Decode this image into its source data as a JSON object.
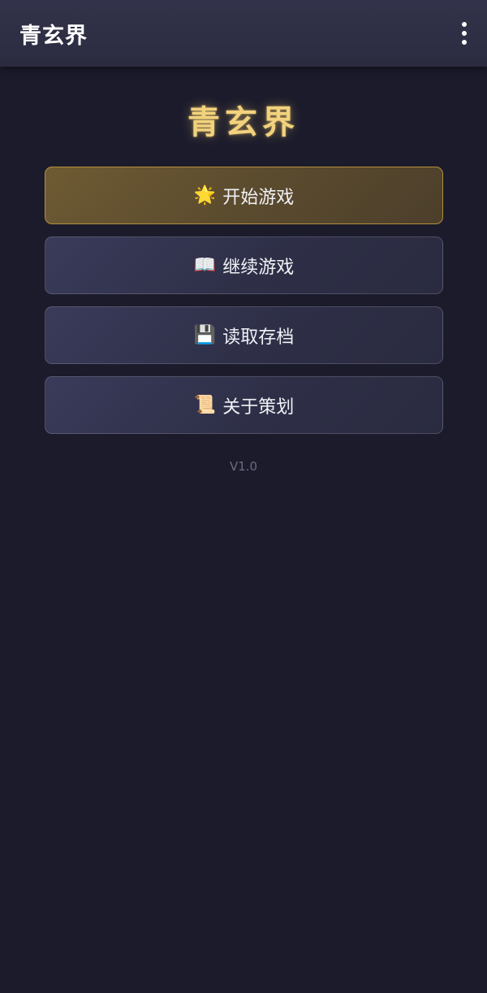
{
  "app_bar": {
    "title": "青玄界",
    "menu_icon": "more-vertical-icon"
  },
  "game": {
    "title": "青玄界",
    "version": "V1.0"
  },
  "menu": {
    "items": [
      {
        "icon": "🌟",
        "icon_name": "star-icon",
        "label": "开始游戏"
      },
      {
        "icon": "📖",
        "icon_name": "book-icon",
        "label": "继续游戏"
      },
      {
        "icon": "💾",
        "icon_name": "floppy-disk-icon",
        "label": "读取存档"
      },
      {
        "icon": "📜",
        "icon_name": "scroll-icon",
        "label": "关于策划"
      }
    ]
  },
  "colors": {
    "background": "#1b1b2c",
    "app_bar": "#2f2f45",
    "title_gold": "#f2d27c",
    "primary_button": "#6e5b33",
    "primary_border": "#b48f3a",
    "secondary_button": "#34354f"
  }
}
